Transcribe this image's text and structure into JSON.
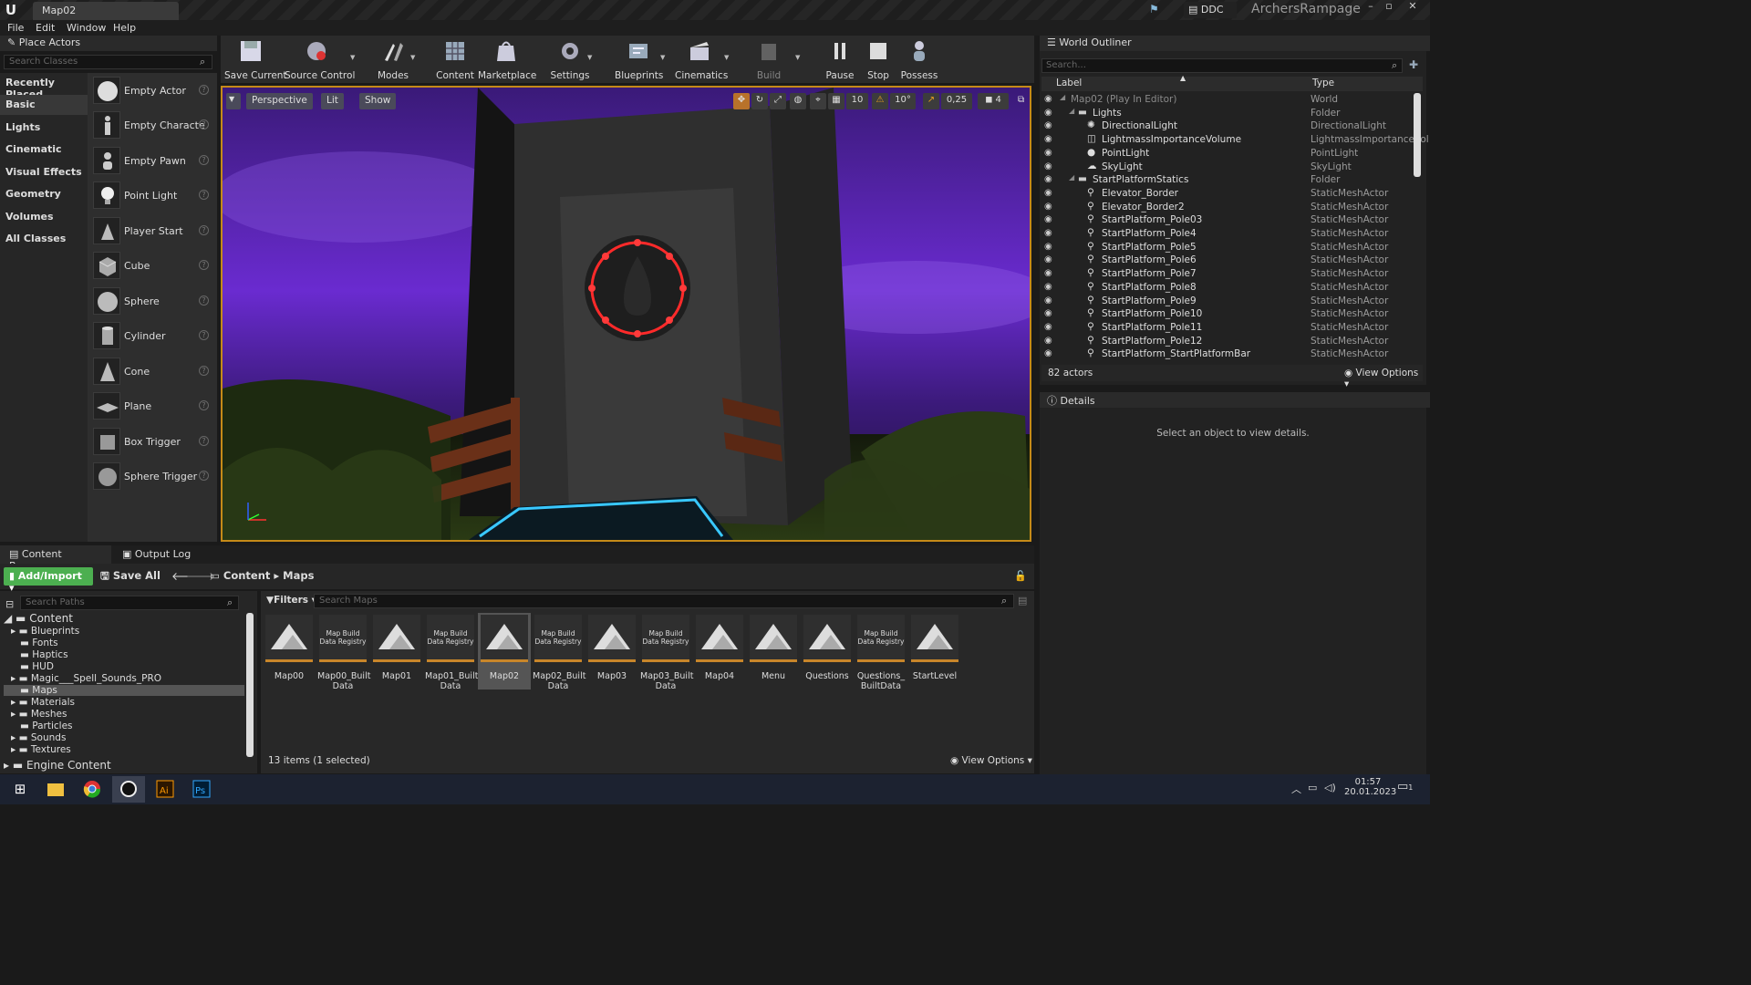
{
  "window": {
    "doc_tab": "Map02",
    "ddc_label": "DDC",
    "project_name": "ArchersRampage"
  },
  "menu": [
    "File",
    "Edit",
    "Window",
    "Help"
  ],
  "place_actors": {
    "tab_label": "Place Actors",
    "search_placeholder": "Search Classes",
    "categories": [
      "Recently Placed",
      "Basic",
      "Lights",
      "Cinematic",
      "Visual Effects",
      "Geometry",
      "Volumes",
      "All Classes"
    ],
    "selected_category": "Basic",
    "actors": [
      "Empty Actor",
      "Empty Characte",
      "Empty Pawn",
      "Point Light",
      "Player Start",
      "Cube",
      "Sphere",
      "Cylinder",
      "Cone",
      "Plane",
      "Box Trigger",
      "Sphere Trigger"
    ]
  },
  "toolbar": {
    "save_current": "Save Current",
    "source_control": "Source Control",
    "modes": "Modes",
    "content": "Content",
    "marketplace": "Marketplace",
    "settings": "Settings",
    "blueprints": "Blueprints",
    "cinematics": "Cinematics",
    "build": "Build",
    "pause": "Pause",
    "stop": "Stop",
    "possess": "Possess"
  },
  "viewport": {
    "perspective": "Perspective",
    "lit": "Lit",
    "show": "Show",
    "grid_snap": "10",
    "rotation_snap": "10°",
    "scale_snap": "0,25",
    "camera_speed": "4"
  },
  "outliner": {
    "tab_label": "World Outliner",
    "search_placeholder": "Search...",
    "col_label": "Label",
    "col_type": "Type",
    "rows": [
      {
        "label": "Map02 (Play In Editor)",
        "type": "World"
      },
      {
        "label": "Lights",
        "type": "Folder"
      },
      {
        "label": "DirectionalLight",
        "type": "DirectionalLight"
      },
      {
        "label": "LightmassImportanceVolume",
        "type": "LightmassImportanceVol"
      },
      {
        "label": "PointLight",
        "type": "PointLight"
      },
      {
        "label": "SkyLight",
        "type": "SkyLight"
      },
      {
        "label": "StartPlatformStatics",
        "type": "Folder"
      },
      {
        "label": "Elevator_Border",
        "type": "StaticMeshActor"
      },
      {
        "label": "Elevator_Border2",
        "type": "StaticMeshActor"
      },
      {
        "label": "StartPlatform_Pole03",
        "type": "StaticMeshActor"
      },
      {
        "label": "StartPlatform_Pole4",
        "type": "StaticMeshActor"
      },
      {
        "label": "StartPlatform_Pole5",
        "type": "StaticMeshActor"
      },
      {
        "label": "StartPlatform_Pole6",
        "type": "StaticMeshActor"
      },
      {
        "label": "StartPlatform_Pole7",
        "type": "StaticMeshActor"
      },
      {
        "label": "StartPlatform_Pole8",
        "type": "StaticMeshActor"
      },
      {
        "label": "StartPlatform_Pole9",
        "type": "StaticMeshActor"
      },
      {
        "label": "StartPlatform_Pole10",
        "type": "StaticMeshActor"
      },
      {
        "label": "StartPlatform_Pole11",
        "type": "StaticMeshActor"
      },
      {
        "label": "StartPlatform_Pole12",
        "type": "StaticMeshActor"
      },
      {
        "label": "StartPlatform_StartPlatformBar",
        "type": "StaticMeshActor"
      }
    ],
    "actor_count": "82 actors",
    "view_options": "View Options"
  },
  "details": {
    "tab_label": "Details",
    "empty_message": "Select an object to view details."
  },
  "content_browser": {
    "tab_label": "Content Browser",
    "output_log_label": "Output Log",
    "add_import": "Add/Import",
    "save_all": "Save All",
    "breadcrumb": [
      "Content",
      "Maps"
    ],
    "search_paths_placeholder": "Search Paths",
    "filters": "Filters",
    "search_maps_placeholder": "Search Maps",
    "tree_root": "Content",
    "folders": [
      "Blueprints",
      "Fonts",
      "Haptics",
      "HUD",
      "Magic___Spell_Sounds_PRO",
      "Maps",
      "Materials",
      "Meshes",
      "Particles",
      "Sounds",
      "Textures"
    ],
    "engine_content": "Engine Content",
    "assets": [
      {
        "name": "Map00",
        "kind": "map"
      },
      {
        "name": "Map00_Built Data",
        "kind": "registry"
      },
      {
        "name": "Map01",
        "kind": "map"
      },
      {
        "name": "Map01_Built Data",
        "kind": "registry"
      },
      {
        "name": "Map02",
        "kind": "map"
      },
      {
        "name": "Map02_Built Data",
        "kind": "registry"
      },
      {
        "name": "Map03",
        "kind": "map"
      },
      {
        "name": "Map03_Built Data",
        "kind": "registry"
      },
      {
        "name": "Map04",
        "kind": "map"
      },
      {
        "name": "Menu",
        "kind": "map"
      },
      {
        "name": "Questions",
        "kind": "map"
      },
      {
        "name": "Questions_ BuiltData",
        "kind": "registry"
      },
      {
        "name": "StartLevel",
        "kind": "map"
      }
    ],
    "registry_thumb_text": "Map Build Data Registry",
    "item_count": "13 items (1 selected)",
    "view_options": "View Options"
  },
  "taskbar": {
    "time": "01:57",
    "date": "20.01.2023",
    "notifications": "1"
  },
  "colors": {
    "accent": "#c58a18",
    "add_import": "#4caf50",
    "ring": "#ff2a2a",
    "sky": "#6a2bd0"
  }
}
